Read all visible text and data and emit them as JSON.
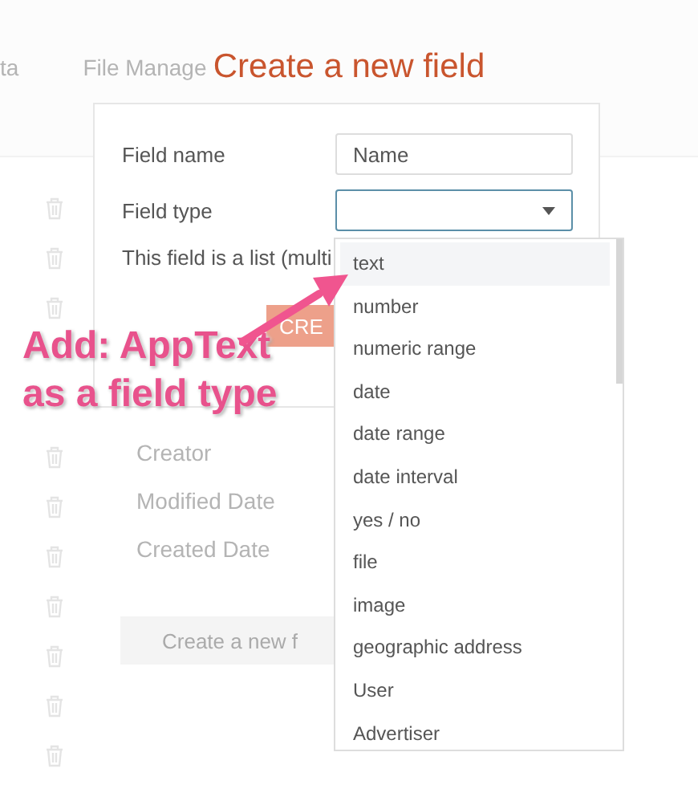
{
  "background": {
    "tabs": [
      {
        "label": "ta"
      },
      {
        "label": "File Manage"
      }
    ],
    "fields": [
      "Creator",
      "Modified Date",
      "Created Date"
    ],
    "create_button": "Create a new f"
  },
  "dialog": {
    "title": "Create a new field",
    "fields": [
      {
        "kind": "text",
        "label": "Field name",
        "value": "Name"
      },
      {
        "kind": "select",
        "label": "Field type",
        "expanded": true
      }
    ],
    "list_label": "This field is a list (multi",
    "submit": "CRE"
  },
  "dropdown": {
    "options": [
      {
        "label": "text",
        "selected": true
      },
      {
        "label": "number",
        "selected": false
      },
      {
        "label": "numeric range",
        "selected": false
      },
      {
        "label": "date",
        "selected": false
      },
      {
        "label": "date range",
        "selected": false
      },
      {
        "label": "date interval",
        "selected": false
      },
      {
        "label": "yes / no",
        "selected": false
      },
      {
        "label": "file",
        "selected": false
      },
      {
        "label": "image",
        "selected": false
      },
      {
        "label": "geographic address",
        "selected": false
      },
      {
        "label": "User",
        "selected": false
      },
      {
        "label": "Advertiser",
        "selected": false
      }
    ]
  },
  "annotation": {
    "lines": [
      "Add: AppText",
      "as a field type"
    ]
  }
}
